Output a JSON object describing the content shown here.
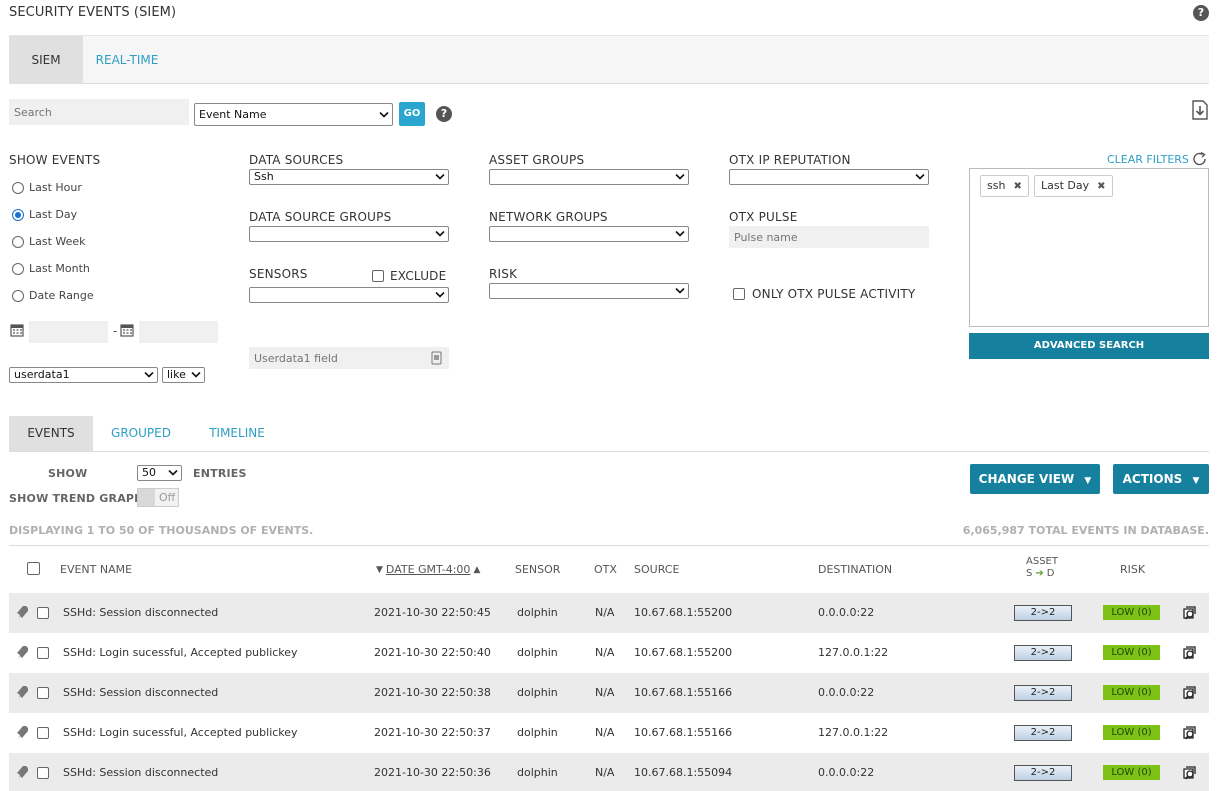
{
  "header": {
    "title": "SECURITY EVENTS (SIEM)",
    "help": "?"
  },
  "tabs": [
    {
      "label": "SIEM",
      "active": true
    },
    {
      "label": "REAL-TIME",
      "active": false
    }
  ],
  "search": {
    "placeholder": "Search",
    "field_value": "Event Name",
    "go_label": "GO",
    "help": "?"
  },
  "show_events": {
    "label": "SHOW EVENTS",
    "options": [
      "Last Hour",
      "Last Day",
      "Last Week",
      "Last Month",
      "Date Range"
    ],
    "selected": "Last Day",
    "date_separator": "-"
  },
  "userdata": {
    "field": "userdata1",
    "operator": "like",
    "value_placeholder": "Userdata1 field"
  },
  "filters": {
    "data_sources": {
      "label": "DATA SOURCES",
      "value": "Ssh"
    },
    "data_source_groups": {
      "label": "DATA SOURCE GROUPS",
      "value": ""
    },
    "sensors": {
      "label": "SENSORS",
      "value": "",
      "exclude_label": "EXCLUDE"
    },
    "asset_groups": {
      "label": "ASSET GROUPS",
      "value": ""
    },
    "network_groups": {
      "label": "NETWORK GROUPS",
      "value": ""
    },
    "risk": {
      "label": "RISK",
      "value": ""
    },
    "otx_ip_reputation": {
      "label": "OTX IP REPUTATION",
      "value": ""
    },
    "otx_pulse": {
      "label": "OTX PULSE",
      "placeholder": "Pulse name"
    },
    "only_otx": {
      "label": "ONLY OTX PULSE ACTIVITY"
    }
  },
  "active_filters": {
    "clear_label": "CLEAR FILTERS",
    "tags": [
      "ssh",
      "Last Day"
    ],
    "advanced_label": "ADVANCED SEARCH"
  },
  "view_tabs": [
    {
      "label": "EVENTS",
      "active": true
    },
    {
      "label": "GROUPED",
      "active": false
    },
    {
      "label": "TIMELINE",
      "active": false
    }
  ],
  "controls": {
    "show_label": "SHOW",
    "entries_value": "50",
    "entries_label": "ENTRIES",
    "trend_label": "SHOW TREND GRAPH",
    "trend_value": "Off",
    "change_view": "CHANGE VIEW",
    "actions": "ACTIONS"
  },
  "summary": {
    "displaying": "DISPLAYING 1 TO 50 OF THOUSANDS OF EVENTS.",
    "total": "6,065,987 TOTAL EVENTS IN DATABASE."
  },
  "table": {
    "headers": {
      "event_name": "EVENT NAME",
      "date": "DATE GMT-4:00",
      "sensor": "SENSOR",
      "otx": "OTX",
      "source": "SOURCE",
      "destination": "DESTINATION",
      "asset_top": "ASSET",
      "asset_bottom_s": "S",
      "asset_bottom_d": "D",
      "risk": "RISK"
    },
    "rows": [
      {
        "name": "SSHd: Session disconnected",
        "date": "2021-10-30 22:50:45",
        "sensor": "dolphin",
        "otx": "N/A",
        "source": "10.67.68.1:55200",
        "destination": "0.0.0.0:22",
        "asset": "2->2",
        "risk": "LOW  (0)"
      },
      {
        "name": "SSHd: Login sucessful, Accepted publickey",
        "date": "2021-10-30 22:50:40",
        "sensor": "dolphin",
        "otx": "N/A",
        "source": "10.67.68.1:55200",
        "destination": "127.0.0.1:22",
        "asset": "2->2",
        "risk": "LOW  (0)"
      },
      {
        "name": "SSHd: Session disconnected",
        "date": "2021-10-30 22:50:38",
        "sensor": "dolphin",
        "otx": "N/A",
        "source": "10.67.68.1:55166",
        "destination": "0.0.0.0:22",
        "asset": "2->2",
        "risk": "LOW  (0)"
      },
      {
        "name": "SSHd: Login sucessful, Accepted publickey",
        "date": "2021-10-30 22:50:37",
        "sensor": "dolphin",
        "otx": "N/A",
        "source": "10.67.68.1:55166",
        "destination": "127.0.0.1:22",
        "asset": "2->2",
        "risk": "LOW  (0)"
      },
      {
        "name": "SSHd: Session disconnected",
        "date": "2021-10-30 22:50:36",
        "sensor": "dolphin",
        "otx": "N/A",
        "source": "10.67.68.1:55094",
        "destination": "0.0.0.0:22",
        "asset": "2->2",
        "risk": "LOW  (0)"
      }
    ]
  },
  "colors": {
    "accent": "#2e9fc4",
    "button_dark": "#16819e",
    "risk_low": "#7dc217"
  },
  "icons": {
    "help": "question-circle-icon",
    "download": "download-icon",
    "refresh": "refresh-icon",
    "calendar": "calendar-icon",
    "tag_remove": "close-icon",
    "row_type": "plug-icon",
    "row_detail": "magnifier-icon"
  }
}
